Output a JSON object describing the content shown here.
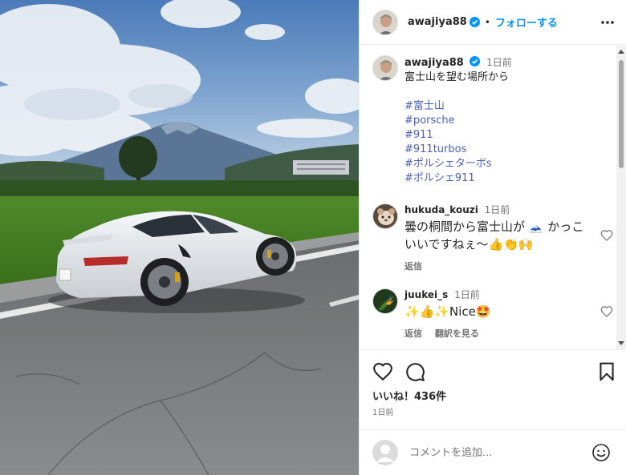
{
  "post": {
    "username": "awajiya88",
    "follow_label": "フォローする",
    "dot": "•",
    "image_alt": "Porsche 911 Turbo S in front of Mount Fuji"
  },
  "caption": {
    "username": "awajiya88",
    "time": "1日前",
    "text": "富士山を望む場所から",
    "hashtags": [
      "#富士山",
      "#porsche",
      "#911",
      "#911turbos",
      "#ポルシェターボs",
      "#ポルシェ911"
    ]
  },
  "comments": [
    {
      "username": "hukuda_kouzi",
      "time": "1日前",
      "text": "曇の桐間から富士山が 🗻 かっこいいですねぇ〜👍👏🙌",
      "actions": [
        "返信"
      ]
    },
    {
      "username": "juukei_s",
      "time": "1日前",
      "text": "✨👍✨Nice🤩",
      "actions": [
        "返信",
        "翻訳を見る"
      ]
    }
  ],
  "likes": {
    "label": "いいね！436件",
    "posted": "1日前"
  },
  "comment_box": {
    "placeholder": "コメントを追加..."
  },
  "colors": {
    "accent": "#0095f6",
    "hashtag": "#4a5fc1",
    "muted": "#737373"
  }
}
